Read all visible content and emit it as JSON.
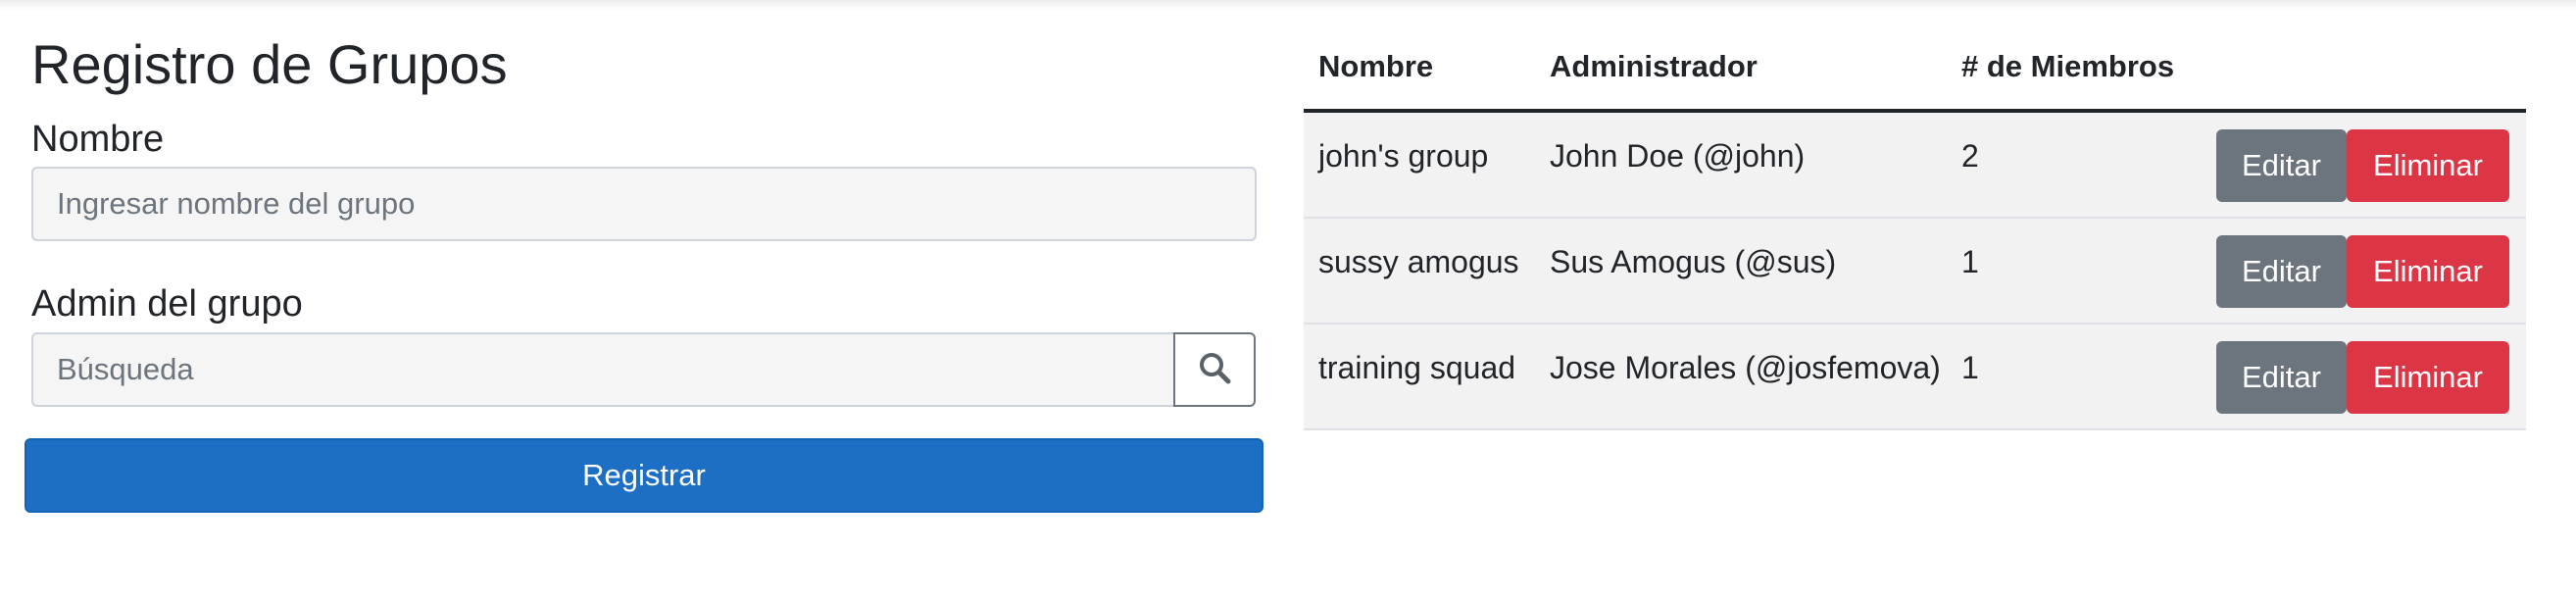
{
  "form": {
    "title": "Registro de Grupos",
    "name_label": "Nombre",
    "name_placeholder": "Ingresar nombre del grupo",
    "admin_label": "Admin del grupo",
    "admin_placeholder": "Búsqueda",
    "search_icon": "magnifier-icon",
    "submit_label": "Registrar"
  },
  "table": {
    "headers": [
      "Nombre",
      "Administrador",
      "# de Miembros"
    ],
    "rows": [
      {
        "name": "john's group",
        "admin": "John Doe (@john)",
        "members": "2"
      },
      {
        "name": "sussy amogus",
        "admin": "Sus Amogus (@sus)",
        "members": "1"
      },
      {
        "name": "training squad",
        "admin": "Jose Morales (@josfemova)",
        "members": "1"
      }
    ],
    "edit_label": "Editar",
    "delete_label": "Eliminar"
  },
  "colors": {
    "primary": "#1c6fc4",
    "secondary": "#6c757d",
    "danger": "#dc3545"
  }
}
